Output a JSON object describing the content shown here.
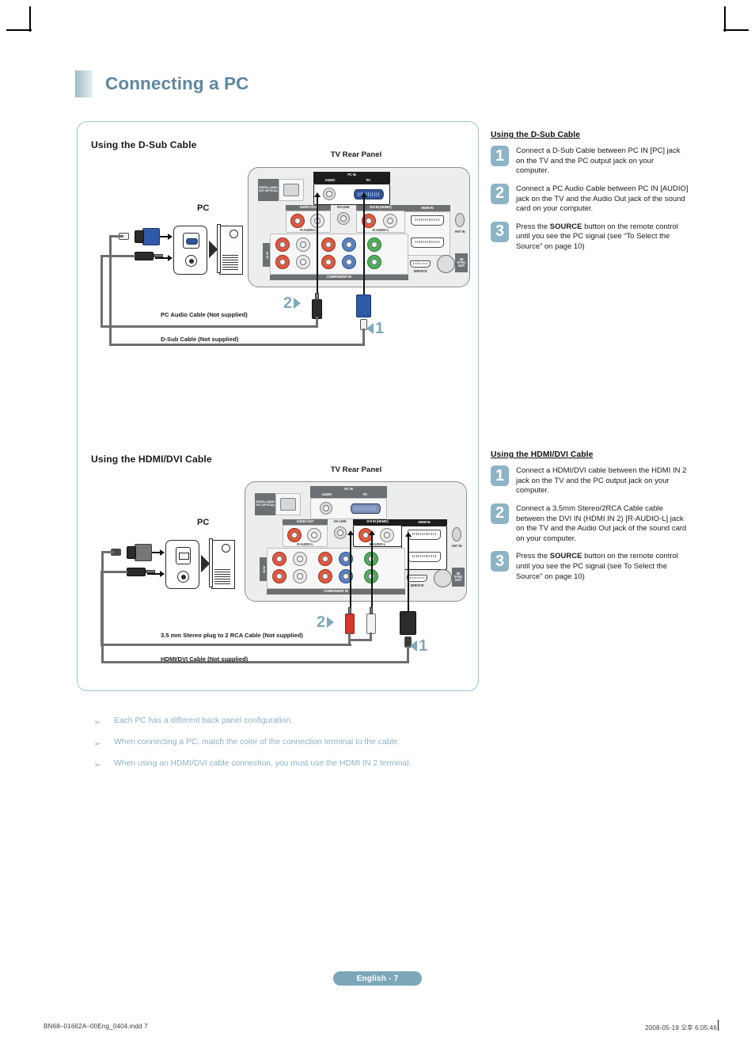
{
  "header": {
    "title": "Connecting a PC"
  },
  "diagrams": [
    {
      "heading": "Using the D-Sub Cable",
      "panel_caption": "TV Rear Panel",
      "pc_caption": "PC",
      "cable_labels": [
        "PC Audio Cable (Not supplied)",
        "D-Sub Cable (Not supplied)"
      ],
      "markers": [
        "2",
        "1"
      ],
      "panel_ports": [
        "DIGITAL AUDIO OUT (OPTICAL)",
        "PC IN",
        "AUDIO",
        "PC",
        "AUDIO OUT",
        "EX-LINK",
        "DVI IN (HDMI2)",
        "HDMI IN",
        "ANT IN",
        "R-AUDIO-L",
        "COMPONENT IN",
        "AV IN",
        "SERVICE",
        "3D SYNC OUT"
      ]
    },
    {
      "heading": "Using the HDMI/DVI Cable",
      "panel_caption": "TV Rear Panel",
      "pc_caption": "PC",
      "cable_labels": [
        "3.5 mm Stereo plug to 2 RCA Cable (Not supplied)",
        "HDMI/DVI Cable (Not supplied)"
      ],
      "markers": [
        "2",
        "1"
      ],
      "panel_ports": [
        "DIGITAL AUDIO OUT (OPTICAL)",
        "PC IN",
        "AUDIO",
        "PC",
        "AUDIO OUT",
        "EX-LINK",
        "DVI IN (HDMI2)",
        "HDMI IN",
        "ANT IN",
        "R-AUDIO-L",
        "COMPONENT IN",
        "AV IN",
        "SERVICE",
        "3D SYNC OUT"
      ]
    }
  ],
  "instructions": [
    {
      "title": "Using the D-Sub Cable",
      "steps": [
        {
          "number": "1",
          "pre": "Connect a D-Sub Cable between PC IN [PC] jack on the TV and the PC output jack on your computer.",
          "bold": "",
          "post": ""
        },
        {
          "number": "2",
          "pre": "Connect a PC Audio Cable between PC IN [AUDIO] jack on the TV and the Audio Out jack of the sound card on your computer.",
          "bold": "",
          "post": ""
        },
        {
          "number": "3",
          "pre": "Press the ",
          "bold": "SOURCE",
          "post": " button on the remote control until you see the  PC signal (see “To Select the Source” on page 10)"
        }
      ]
    },
    {
      "title": "Using the HDMI/DVI Cable",
      "steps": [
        {
          "number": "1",
          "pre": "Connect a HDMI/DVI cable between the HDMI IN 2 jack on the TV and the PC output jack on your computer.",
          "bold": "",
          "post": ""
        },
        {
          "number": "2",
          "pre": "Connect a 3.5mm Stereo/2RCA Cable cable between the DVI IN (HDMI IN 2) [R-AUDIO-L] jack on the TV and the Audio Out jack of the sound card on your computer.",
          "bold": "",
          "post": ""
        },
        {
          "number": "3",
          "pre": "Press the ",
          "bold": "SOURCE",
          "post": " button on the remote control until you see the  PC signal (see To Select the Source\" on page 10)"
        }
      ]
    }
  ],
  "notes": [
    "Each PC has a different back panel configuration.",
    "When connecting a PC, match the color of the connection terminal to the cable.",
    "When using an HDMI/DVI cable connection, you must use the HDMI IN 2 terminal."
  ],
  "note_bullet": "➢",
  "footer": {
    "page_label": "English - 7",
    "print_file": "BN68–01662A–00Eng_0404.indd   7",
    "print_date": "2008-05-19   오후 6:05:46"
  },
  "colors": {
    "title": "#5e87a0",
    "badge": "#8cb4c6",
    "border": "#9dc3d4",
    "note": "#8fb0c4",
    "footer_pill": "#7ba7b8"
  }
}
